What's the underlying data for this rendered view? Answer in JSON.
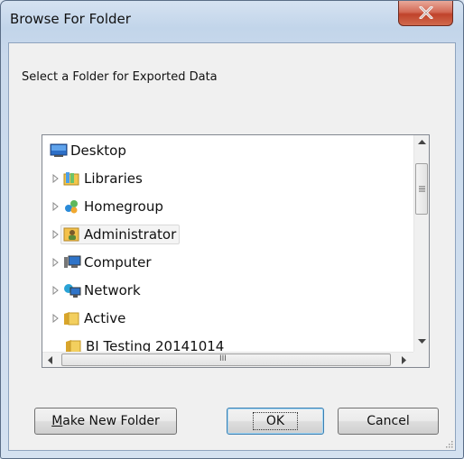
{
  "window": {
    "title": "Browse For Folder",
    "close_glyph": "X"
  },
  "dialog": {
    "prompt": "Select a Folder for Exported Data"
  },
  "tree": {
    "items": [
      {
        "label": "Desktop",
        "icon": "desktop-icon",
        "expandable": false
      },
      {
        "label": "Libraries",
        "icon": "libraries-icon",
        "expandable": true
      },
      {
        "label": "Homegroup",
        "icon": "homegroup-icon",
        "expandable": true
      },
      {
        "label": "Administrator",
        "icon": "user-folder-icon",
        "expandable": true,
        "selected": true
      },
      {
        "label": "Computer",
        "icon": "computer-icon",
        "expandable": true
      },
      {
        "label": "Network",
        "icon": "network-icon",
        "expandable": true
      },
      {
        "label": "Active",
        "icon": "folder-icon",
        "expandable": true
      },
      {
        "label": "BI Testing 20141014",
        "icon": "folder-icon",
        "expandable": false
      }
    ],
    "hscroll_grip": "III"
  },
  "buttons": {
    "new_folder_prefix": "M",
    "new_folder_rest": "ake New Folder",
    "ok": "OK",
    "cancel": "Cancel"
  },
  "colors": {
    "title_bar": "#c2d5ea",
    "close_button": "#c0432b",
    "default_button_border": "#3c7fb1"
  }
}
